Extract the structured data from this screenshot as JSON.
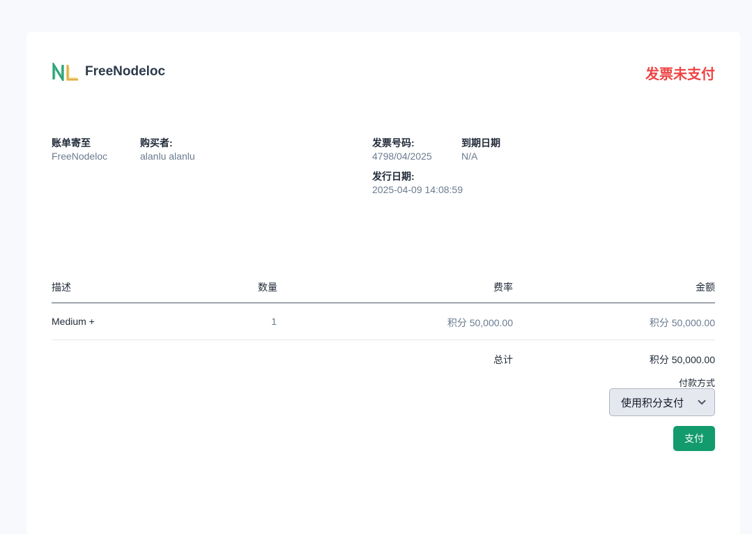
{
  "header": {
    "brand_name": "FreeNodeloc",
    "logo_icon": "nl-logo-icon",
    "status": "发票未支付",
    "status_color": "#ef4444"
  },
  "billing": {
    "bill_to_label": "账单寄至",
    "bill_to_value": "FreeNodeloc",
    "buyer_label": "购买者:",
    "buyer_value": "alanlu alanlu"
  },
  "invoice": {
    "number_label": "发票号码:",
    "number_value": "4798/04/2025",
    "due_label": "到期日期",
    "due_value": "N/A",
    "issued_label": "发行日期:",
    "issued_value": "2025-04-09 14:08:59"
  },
  "table": {
    "headers": [
      "描述",
      "数量",
      "费率",
      "金额"
    ],
    "rows": [
      [
        "Medium +",
        "1",
        "积分 50,000.00",
        "积分 50,000.00"
      ]
    ],
    "total_label": "总计",
    "total_value": "积分 50,000.00"
  },
  "payment": {
    "method_label": "付款方式",
    "method_selected": "使用积分支付",
    "pay_button": "支付",
    "button_color": "#139b6d"
  }
}
